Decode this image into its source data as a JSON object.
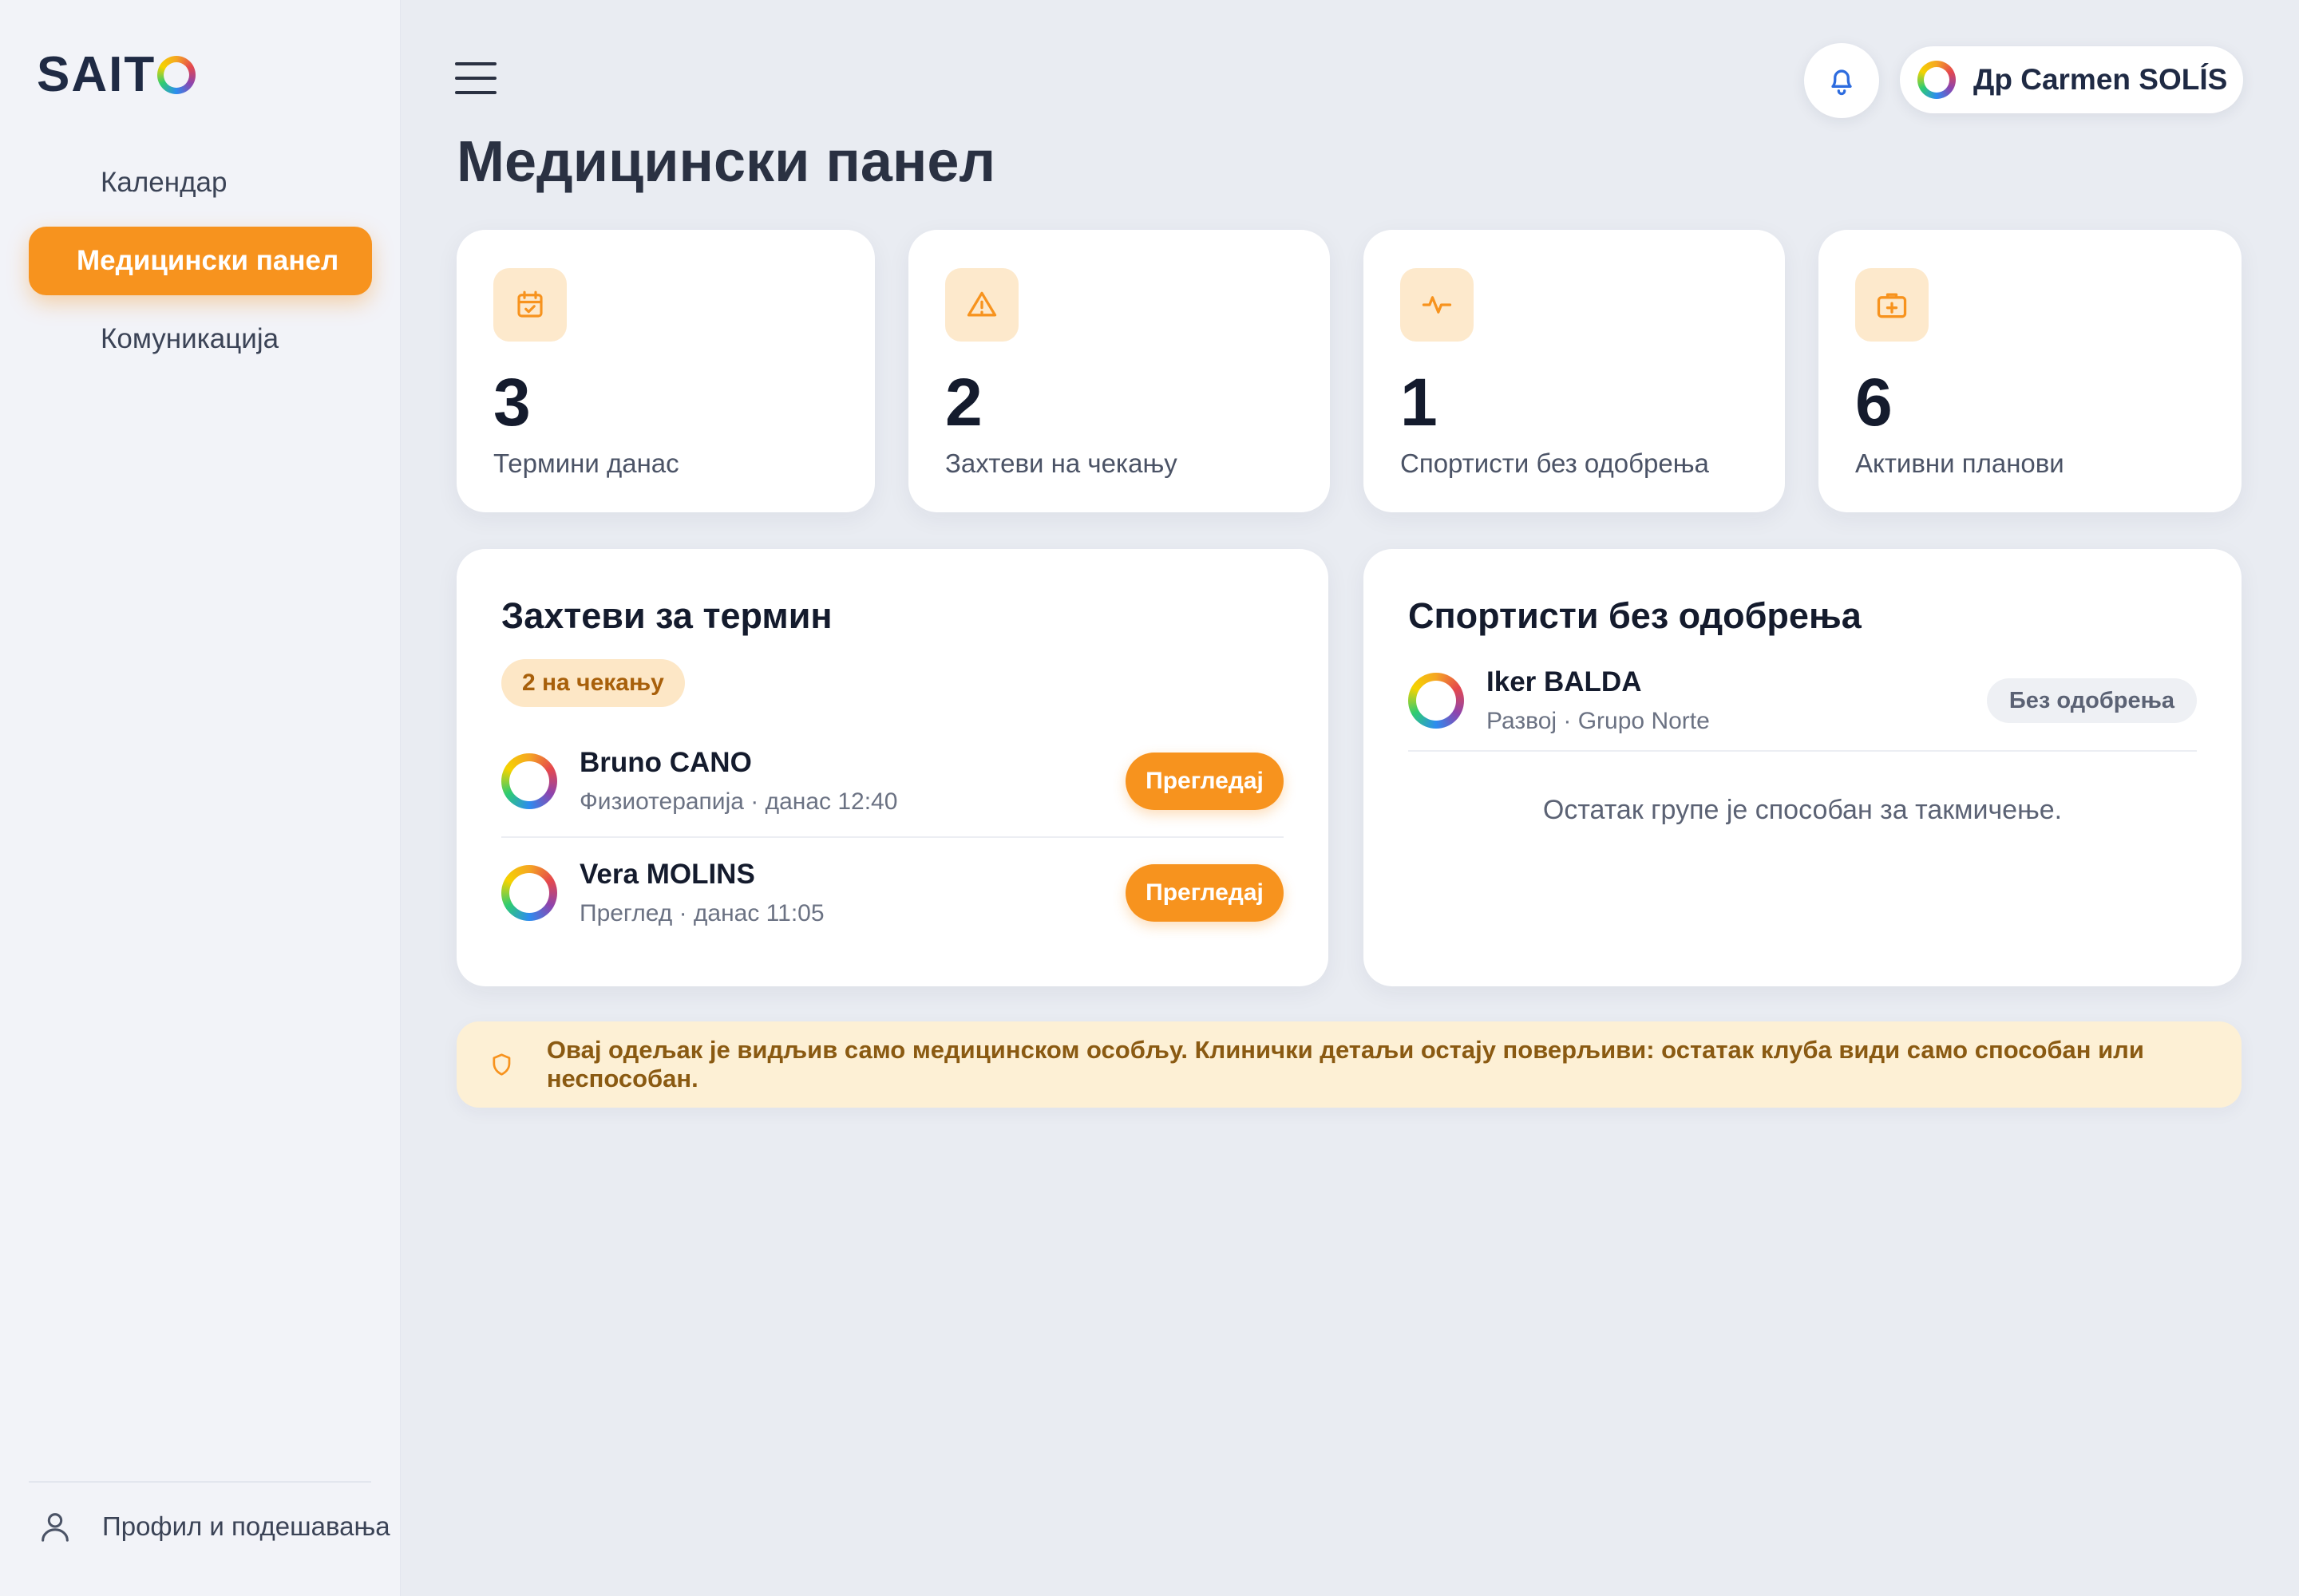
{
  "app": {
    "logo_text": "SAIT",
    "page_title": "Медицински панел"
  },
  "sidebar": {
    "items": [
      {
        "label": "Календар",
        "active": false
      },
      {
        "label": "Медицински панел",
        "active": true
      },
      {
        "label": "Комуникација",
        "active": false
      }
    ],
    "profile_label": "Профил и подешавања"
  },
  "header": {
    "user_name": "Др Carmen SOLÍS",
    "icons": [
      "menu-icon",
      "bell-icon"
    ]
  },
  "stats": [
    {
      "value": "3",
      "label": "Термини данас",
      "icon": "calendar-check-icon"
    },
    {
      "value": "2",
      "label": "Захтеви на чекању",
      "icon": "warning-icon"
    },
    {
      "value": "1",
      "label": "Спортисти без одобрења",
      "icon": "pulse-icon"
    },
    {
      "value": "6",
      "label": "Активни планови",
      "icon": "medkit-icon"
    }
  ],
  "requests": {
    "title": "Захтеви за термин",
    "badge": "2 на чекању",
    "items": [
      {
        "name": "Bruno CANO",
        "meta": "Физиотерапија · данас 12:40",
        "action": "Прегледај"
      },
      {
        "name": "Vera MOLINS",
        "meta": "Преглед · данас 11:05",
        "action": "Прегледај"
      }
    ]
  },
  "unapproved": {
    "title": "Спортисти без одобрења",
    "items": [
      {
        "name": "Iker BALDA",
        "meta": "Развој · Grupo Norte",
        "status": "Без одобрења"
      }
    ],
    "note": "Остатак групе је способан за такмичење."
  },
  "notice": {
    "text": "Овај одељак је видљив само медицинском особљу. Клинички детаљи остају поверљиви: остатак клуба види само способан или неспособан."
  },
  "colors": {
    "accent": "#f7931e",
    "accent_soft": "#fde9cc",
    "notice_bg": "#fdf0d5",
    "text_dark": "#141b2d"
  }
}
